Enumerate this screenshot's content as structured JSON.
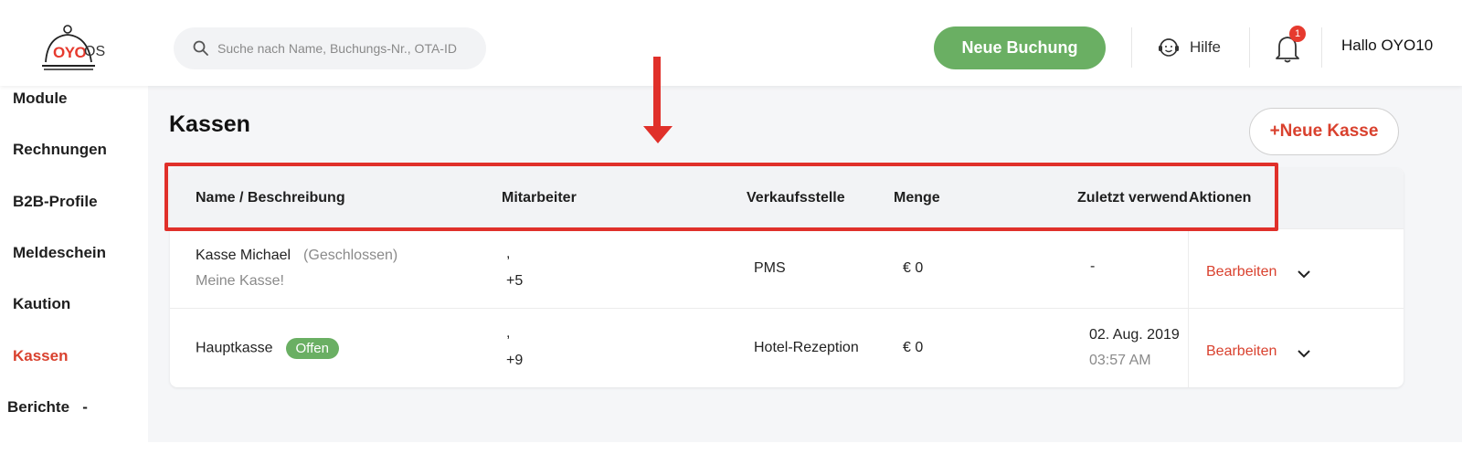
{
  "header": {
    "logo": {
      "brand": "OYO",
      "suffix": "OS"
    },
    "search": {
      "placeholder": "Suche nach Name, Buchungs-Nr., OTA-ID",
      "value": ""
    },
    "new_booking_label": "Neue Buchung",
    "help_label": "Hilfe",
    "notification_count": "1",
    "greeting": "Hallo OYO10"
  },
  "sidebar": {
    "items": [
      {
        "label": "Module",
        "active": false
      },
      {
        "label": "Rechnungen",
        "active": false
      },
      {
        "label": "B2B-Profile",
        "active": false
      },
      {
        "label": "Meldeschein",
        "active": false
      },
      {
        "label": "Kaution",
        "active": false
      },
      {
        "label": "Kassen",
        "active": true
      },
      {
        "label": "Berichte   -",
        "active": false
      }
    ]
  },
  "main": {
    "title": "Kassen",
    "new_kasse_label": "+Neue Kasse",
    "table": {
      "columns": [
        "Name / Beschreibung",
        "Mitarbeiter",
        "Verkaufsstelle",
        "Menge",
        "Zuletzt verwend",
        "Aktionen"
      ],
      "rows": [
        {
          "name": "Kasse Michael",
          "status": "(Geschlossen)",
          "description": "Meine Kasse!",
          "staff_line1": ",",
          "staff_line2": "+5",
          "pos": "PMS",
          "amount": "€ 0",
          "last_used": "-",
          "last_used_time": "",
          "action": "Bearbeiten"
        },
        {
          "name": "Hauptkasse",
          "status": "Offen",
          "description": "",
          "staff_line1": ",",
          "staff_line2": "+9",
          "pos": "Hotel-Rezeption",
          "amount": "€ 0",
          "last_used": "02. Aug. 2019",
          "last_used_time": "03:57 AM",
          "action": "Bearbeiten"
        }
      ]
    }
  },
  "colors": {
    "brand_red": "#e63a2e",
    "accent_green": "#6aaf63",
    "active_link": "#d9412e",
    "annotation_red": "#e0302a"
  },
  "icons": [
    "search-icon",
    "help-headset-icon",
    "bell-icon",
    "chevron-down-icon",
    "cloche-logo-icon",
    "arrow-down-annotation"
  ]
}
